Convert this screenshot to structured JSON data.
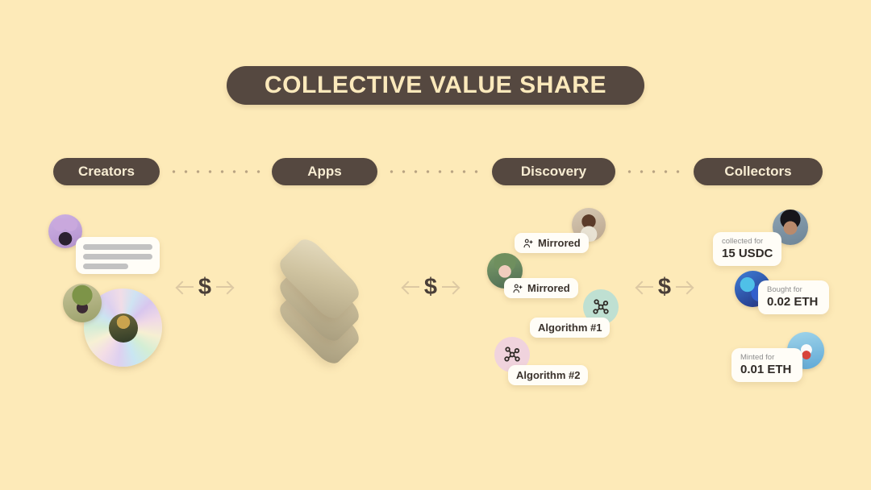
{
  "theme": {
    "background": "#fdeab8",
    "brand_dark": "#554840",
    "brand_cream": "#fbe9bb",
    "card_background": "#fffdf7"
  },
  "title": {
    "text": "COLLECTIVE VALUE SHARE"
  },
  "stages": [
    {
      "label": "Creators"
    },
    {
      "label": "Apps"
    },
    {
      "label": "Discovery"
    },
    {
      "label": "Collectors"
    }
  ],
  "connectors": [
    {
      "symbol": "$"
    },
    {
      "symbol": "$"
    },
    {
      "symbol": "$"
    }
  ],
  "discovery": {
    "chips": [
      {
        "label": "Mirrored",
        "icon": "person-add-icon"
      },
      {
        "label": "Mirrored",
        "icon": "person-add-icon"
      },
      {
        "label": "Algorithm #1",
        "icon": "network-nodes-icon",
        "accent": "#bfe0d2"
      },
      {
        "label": "Algorithm #2",
        "icon": "network-nodes-icon",
        "accent": "#f0d3dd"
      }
    ]
  },
  "collectors": {
    "cards": [
      {
        "caption": "collected for",
        "value": "15 USDC"
      },
      {
        "caption": "Bought for",
        "value": "0.02 ETH"
      },
      {
        "caption": "Minted for",
        "value": "0.01 ETH"
      }
    ]
  }
}
